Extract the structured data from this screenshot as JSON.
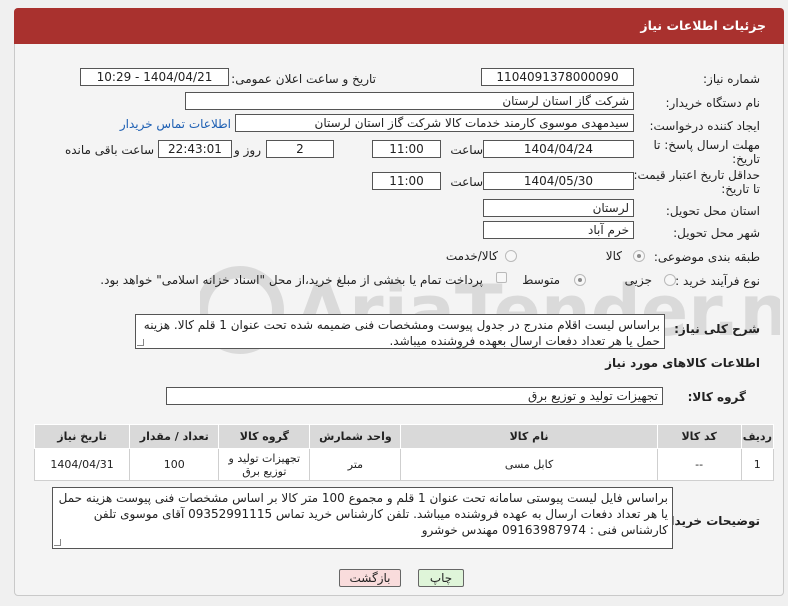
{
  "header": {
    "title": "جزئیات اطلاعات نیاز"
  },
  "fields": {
    "need_number": {
      "label": "شماره نیاز:",
      "value": "1104091378000090"
    },
    "announce_datetime": {
      "label": "تاریخ و ساعت اعلان عمومی:",
      "value": "1404/04/21 - 10:29"
    },
    "buyer_org": {
      "label": "نام دستگاه خریدار:",
      "value": "شرکت گاز استان لرستان"
    },
    "requester": {
      "label": "ایجاد کننده درخواست:",
      "value": "سیدمهدی موسوی کارمند خدمات کالا شرکت گاز استان لرستان",
      "contact_link": "اطلاعات تماس خریدار"
    },
    "response_deadline": {
      "label_line1": "مهلت ارسال پاسخ: تا",
      "label_line2": "تاریخ:",
      "date": "1404/04/24",
      "time_label": "ساعت",
      "time": "11:00",
      "days": "2",
      "days_label": "روز و",
      "remaining": "22:43:01",
      "remaining_label": "ساعت باقی مانده"
    },
    "price_validity": {
      "label_line1": "حداقل تاریخ اعتبار قیمت:",
      "label_line2": "تا تاریخ:",
      "date": "1404/05/30",
      "time_label": "ساعت",
      "time": "11:00"
    },
    "delivery_province": {
      "label": "استان محل تحویل:",
      "value": "لرستان"
    },
    "delivery_city": {
      "label": "شهر محل تحویل:",
      "value": "خرم آباد"
    },
    "category": {
      "label": "طبقه بندی موضوعی:",
      "options": [
        "کالا",
        "کالا/خدمت"
      ]
    },
    "purchase_process": {
      "label": "نوع فرآیند خرید :",
      "options": [
        "جزیی",
        "متوسط"
      ],
      "note": "پرداخت تمام یا بخشی از مبلغ خرید،از محل \"اسناد خزانه اسلامی\" خواهد بود."
    }
  },
  "description": {
    "label": "شرح کلی نیاز:",
    "text": "براساس لیست اقلام مندرج در جدول پیوست ومشخصات فنی ضمیمه شده تحت عنوان 1 قلم کالا. هزینه حمل یا هر تعداد دفعات ارسال بعهده فروشنده میباشد."
  },
  "goods_info": {
    "title": "اطلاعات کالاهای مورد نیاز",
    "group_label": "گروه کالا:",
    "group_value": "تجهیزات تولید و توزیع برق"
  },
  "table": {
    "headers": [
      "ردیف",
      "کد کالا",
      "نام کالا",
      "واحد شمارش",
      "گروه کالا",
      "تعداد / مقدار",
      "تاریخ نیاز"
    ],
    "rows": [
      [
        "1",
        "--",
        "کابل مسی",
        "متر",
        "تجهیزات تولید و توزیع برق",
        "100",
        "1404/04/31"
      ]
    ]
  },
  "buyer_notes": {
    "label": "توضیحات خریدار:",
    "text": "براساس  فایل لیست پیوستی سامانه تحت عنوان 1 قلم و مجموع 100 متر کالا بر اساس مشخصات فنی پیوست هزینه حمل یا هر تعداد دفعات ارسال به عهده فروشنده میباشد. تلفن کارشناس خرید تماس 09352991115 آقای موسوی تلفن کارشناس فنی : 09163987974 مهندس خوشرو"
  },
  "buttons": {
    "print": "چاپ",
    "back": "بازگشت"
  },
  "watermark": {
    "text": "AriaTender.neT"
  },
  "colors": {
    "header": "#a9312e",
    "link": "#1d5fb3",
    "print_btn": "#dff5d9",
    "back_btn": "#f9dcdc"
  }
}
